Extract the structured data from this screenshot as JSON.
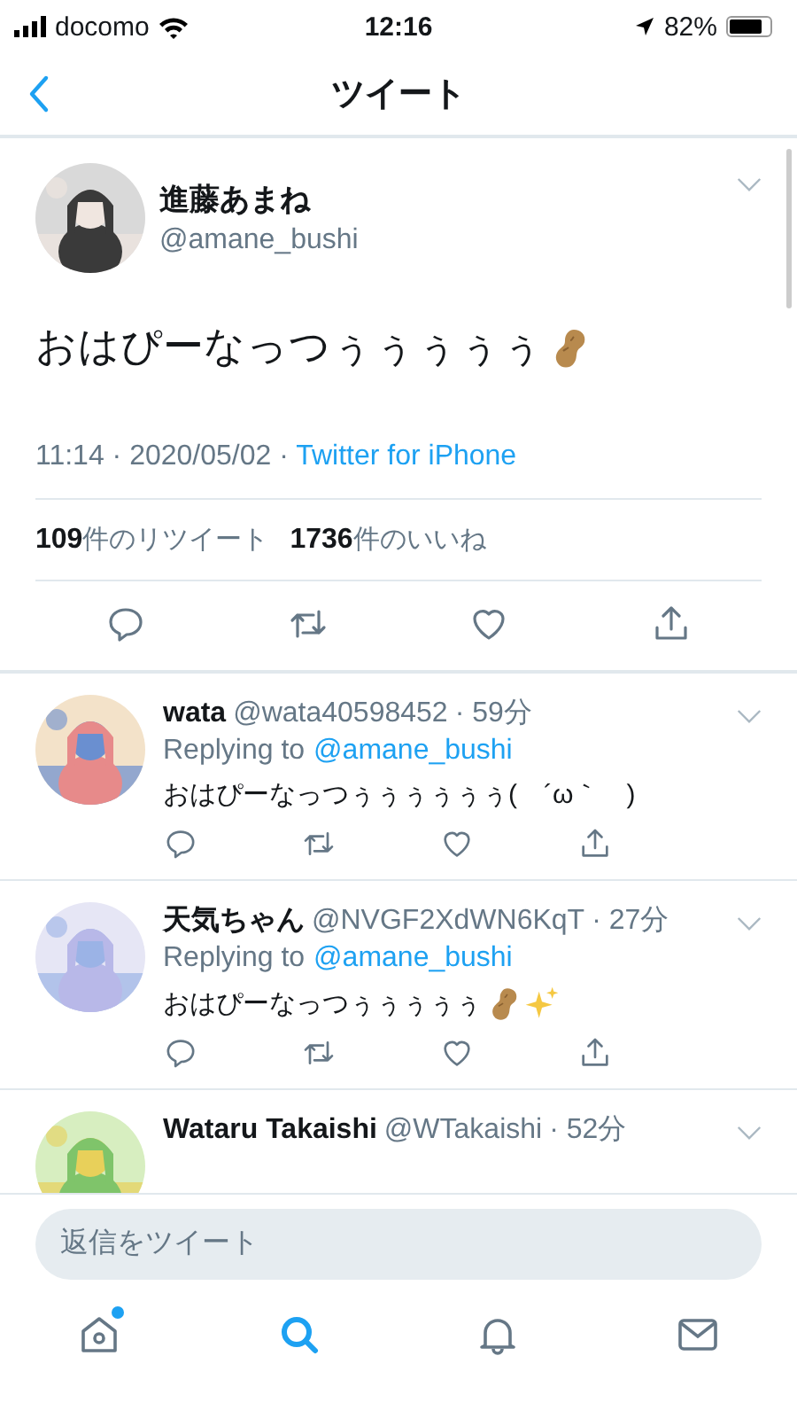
{
  "status_bar": {
    "carrier": "docomo",
    "time": "12:16",
    "battery": "82%"
  },
  "nav": {
    "title": "ツイート"
  },
  "tweet": {
    "name": "進藤あまね",
    "handle": "@amane_bushi",
    "text": "おはぴーなっつぅぅぅぅぅ",
    "trailing_icons": [
      {
        "kind": "peanut"
      }
    ],
    "timestamp": "11:14 · 2020/05/02 · ",
    "source": "Twitter for iPhone",
    "retweets": "109",
    "retweets_label": "件のリツイート",
    "likes": "1736",
    "likes_label": "件のいいね"
  },
  "replies": [
    {
      "name": "wata",
      "handle": "@wata40598452",
      "time": "· 59分",
      "replying_label": "Replying to",
      "replying_to": "@amane_bushi",
      "text": "おはぴーなっつぅぅぅぅぅぅ(　´ω｀　)"
    },
    {
      "name": "天気ちゃん",
      "handle": "@NVGF2XdWN6KqT",
      "time": "· 27分",
      "replying_label": "Replying to",
      "replying_to": "@amane_bushi",
      "text": "おはぴーなっつぅぅぅぅぅ",
      "trailing_icons": [
        {
          "kind": "peanut"
        },
        {
          "kind": "sparkles"
        }
      ]
    },
    {
      "name": "Wataru Takaishi",
      "handle": "@WTakaishi",
      "time": "· 52分"
    }
  ],
  "compose": {
    "placeholder": "返信をツイート"
  },
  "tab_bar": [
    {
      "selected": false,
      "badge": true
    },
    {
      "selected": true,
      "badge": false
    },
    {
      "selected": false,
      "badge": false
    },
    {
      "selected": false,
      "badge": false
    }
  ]
}
